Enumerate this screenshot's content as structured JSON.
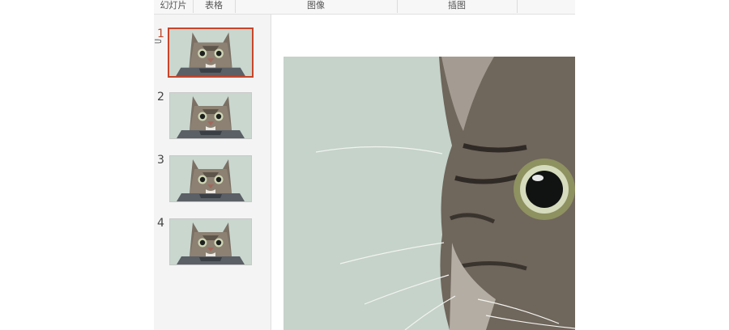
{
  "ribbon": {
    "groups": [
      {
        "label": "幻灯片"
      },
      {
        "label": "表格"
      },
      {
        "label": "图像"
      },
      {
        "label": "插图"
      }
    ]
  },
  "thumbnails": [
    {
      "number": "1",
      "selected": true,
      "icon": "cat-photo"
    },
    {
      "number": "2",
      "selected": false,
      "icon": "cat-photo"
    },
    {
      "number": "3",
      "selected": false,
      "icon": "cat-photo"
    },
    {
      "number": "4",
      "selected": false,
      "icon": "cat-photo"
    }
  ],
  "colors": {
    "accent": "#c8452a",
    "slide_background": "#c9d7cf"
  },
  "slide": {
    "image": "cat-photo"
  }
}
